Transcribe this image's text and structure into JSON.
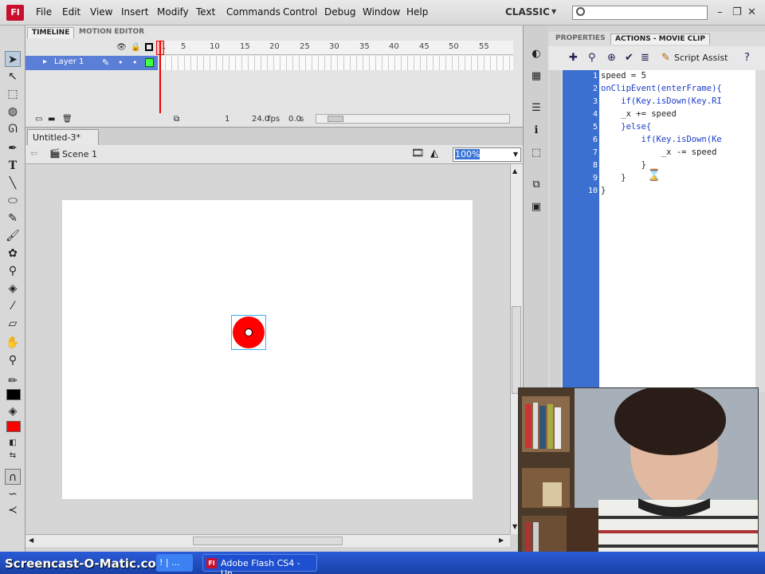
{
  "app": {
    "logo_text": "Fl",
    "workspace": "CLASSIC"
  },
  "menu": [
    "File",
    "Edit",
    "View",
    "Insert",
    "Modify",
    "Text",
    "Commands",
    "Control",
    "Debug",
    "Window",
    "Help"
  ],
  "window_controls": {
    "minimize": "–",
    "restore": "❐",
    "close": "✕"
  },
  "timeline": {
    "tabs": [
      "TIMELINE",
      "MOTION EDITOR"
    ],
    "layer_name": "Layer 1",
    "frame_numbers": [
      "1",
      "5",
      "10",
      "15",
      "20",
      "25",
      "30",
      "35",
      "40",
      "45",
      "50",
      "55"
    ],
    "current_frame": "1",
    "fps": "24.0",
    "fps_unit": "fps",
    "time": "0.0",
    "time_unit": "s"
  },
  "document": {
    "tab_title": "Untitled-3*",
    "scene": "Scene 1",
    "zoom": "100%"
  },
  "colors": {
    "stroke": "#000000",
    "fill": "#ff0000",
    "accent": "#3b6fd0"
  },
  "actions_panel": {
    "tabs": [
      "PROPERTIES",
      "ACTIONS - MOVIE CLIP"
    ],
    "script_assist": "Script Assist",
    "code_lines": [
      {
        "num": "1",
        "text": "speed = 5"
      },
      {
        "num": "2",
        "text": "onClipEvent(enterFrame){"
      },
      {
        "num": "3",
        "text": "    if(Key.isDown(Key.RI"
      },
      {
        "num": "4",
        "text": "    _x += speed"
      },
      {
        "num": "5",
        "text": "    }else{"
      },
      {
        "num": "6",
        "text": "        if(Key.isDown(Ke"
      },
      {
        "num": "7",
        "text": "            _x -= speed"
      },
      {
        "num": "8",
        "text": "        }"
      },
      {
        "num": "9",
        "text": "    }"
      },
      {
        "num": "10",
        "text": "}"
      }
    ]
  },
  "taskbar": {
    "brand": "Screencast-O-Matic.com",
    "item1": "! | ...",
    "item2": "Adobe Flash CS4 - Un..."
  }
}
